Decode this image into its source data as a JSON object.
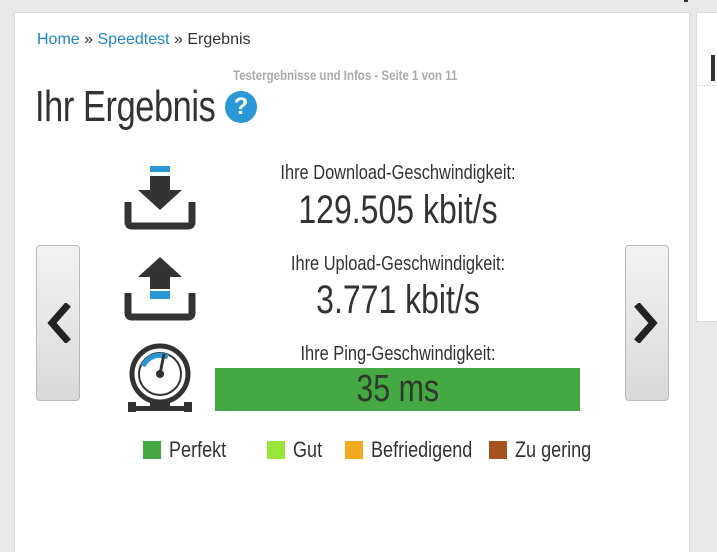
{
  "breadcrumb": {
    "home": "Home",
    "separator": "»",
    "speedtest": "Speedtest",
    "current": "Ergebnis"
  },
  "page_info": "Testergebnisse und Infos - Seite 1 von 11",
  "title": "Ihr Ergebnis",
  "help_icon": "?",
  "download": {
    "label": "Ihre Download-Geschwindigkeit:",
    "value": "129.505 kbit/s"
  },
  "upload": {
    "label": "Ihre Upload-Geschwindigkeit:",
    "value": "3.771 kbit/s"
  },
  "ping": {
    "label": "Ihre Ping-Geschwindigkeit:",
    "value": "35 ms",
    "rating_color": "#44a942"
  },
  "legend": [
    {
      "label": "Perfekt",
      "color": "#44a942"
    },
    {
      "label": "Gut",
      "color": "#99e63a"
    },
    {
      "label": "Befriedigend",
      "color": "#f4aa1e"
    },
    {
      "label": "Zu gering",
      "color": "#a5521e"
    }
  ],
  "icons": {
    "prev": "chevron-left-icon",
    "next": "chevron-right-icon",
    "download": "download-icon",
    "upload": "upload-icon",
    "ping": "gauge-icon"
  }
}
